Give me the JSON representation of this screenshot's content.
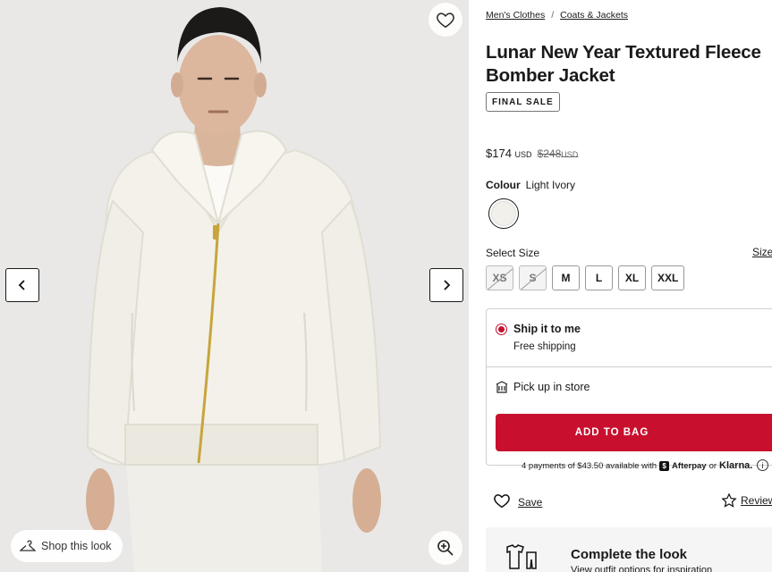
{
  "gallery": {
    "wishlist_icon": "heart-icon",
    "prev_icon": "chevron-left-icon",
    "next_icon": "chevron-right-icon",
    "shop_look_label": "Shop this look",
    "zoom_icon": "zoom-in-icon"
  },
  "breadcrumb": {
    "items": [
      "Men's Clothes",
      "Coats & Jackets"
    ],
    "separator": "/"
  },
  "product": {
    "title": "Lunar New Year Textured Fleece Bomber Jacket",
    "badge": "FINAL SALE",
    "price_now": "$174",
    "currency": "USD",
    "price_was": "$248",
    "currency_was": "USD",
    "colour_label": "Colour",
    "colour_value": "Light Ivory",
    "swatch_color": "#f2f0ea"
  },
  "sizes": {
    "label": "Select Size",
    "guide_label": "Size",
    "options": [
      {
        "label": "XS",
        "available": false
      },
      {
        "label": "S",
        "available": false
      },
      {
        "label": "M",
        "available": true
      },
      {
        "label": "L",
        "available": true
      },
      {
        "label": "XL",
        "available": true
      },
      {
        "label": "XXL",
        "available": true
      }
    ]
  },
  "shipping": {
    "ship_title": "Ship it to me",
    "ship_sub": "Free shipping",
    "pickup_label": "Pick up in store",
    "add_to_bag": "ADD TO BAG",
    "accent_color": "#c8102e"
  },
  "payment": {
    "text": "4 payments of $43.50 available with",
    "afterpay": "Afterpay",
    "or": "or",
    "klarna": "Klarna."
  },
  "actions": {
    "save_label": "Save",
    "review_label": "Review"
  },
  "complete_look": {
    "title": "Complete the look",
    "subtitle": "View outfit options for inspiration"
  }
}
